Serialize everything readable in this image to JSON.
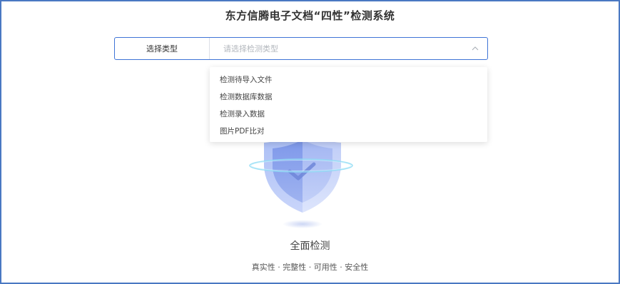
{
  "page": {
    "title": "东方信腾电子文档“四性”检测系统"
  },
  "selector": {
    "label": "选择类型",
    "placeholder": "请选择检测类型",
    "options": [
      "检测待导入文件",
      "检测数据库数据",
      "检测录入数据",
      "图片PDF比对"
    ]
  },
  "hero": {
    "icon": "shield-check-icon",
    "caption": "全面检测",
    "subcaption": "真实性 · 完整性 · 可用性 · 安全性"
  },
  "colors": {
    "frame_border": "#4a78c2",
    "select_border": "#3f74d6",
    "shield_light": "#cfdaf9",
    "shield_dark": "#8fa8ee",
    "ring": "#7fd8f3"
  }
}
